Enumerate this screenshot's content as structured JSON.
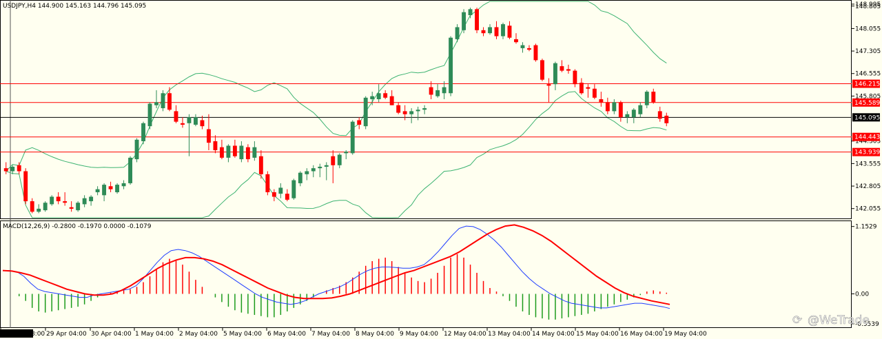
{
  "header": {
    "price_title": "USDJPY,H4  144.900 145.163 144.796 145.095",
    "macd_title": "MACD(12,26,9) -0.2800 -0.1970 0.0000 -0.1079"
  },
  "watermark": "@WeTrade",
  "colors": {
    "background": "#fffff0",
    "bull": "#2e8b57",
    "bear": "#ff0000",
    "band": "#3cb371",
    "hline": "#ff0000",
    "signal": "#ff0000",
    "macd_line": "#1e3cff"
  },
  "chart_data": [
    {
      "type": "candlestick",
      "symbol": "USDJPY",
      "timeframe": "H4",
      "ylim": [
        141.75,
        148.96
      ],
      "price_axis_ticks": [
        "148.995",
        "148.805",
        "148.055",
        "147.305",
        "146.555",
        "145.805",
        "144.305",
        "143.555",
        "142.805",
        "142.055"
      ],
      "price_axis_tick_values": [
        148.995,
        148.805,
        148.055,
        147.305,
        146.555,
        145.805,
        144.305,
        143.555,
        142.805,
        142.055
      ],
      "horizontal_lines": [
        {
          "label": "146.215",
          "value": 146.215
        },
        {
          "label": "145.589",
          "value": 145.589
        },
        {
          "label": "144.443",
          "value": 144.443
        },
        {
          "label": "143.939",
          "value": 143.939
        }
      ],
      "current_price": {
        "label": "145.095",
        "value": 145.095
      },
      "x_axis_labels": [
        "26.04.28 8:00",
        "29 Apr 04:00",
        "30 Apr 04:00",
        "1 May 04:00",
        "2 May 04:00",
        "5 May 04:00",
        "6 May 04:00",
        "7 May 04:00",
        "8 May 04:00",
        "9 May 04:00",
        "12 May 04:00",
        "13 May 04:00",
        "14 May 04:00",
        "15 May 04:00",
        "16 May 04:00",
        "19 May 04:00"
      ],
      "candles": [
        [
          143.4,
          143.6,
          143.2,
          143.3
        ],
        [
          143.3,
          143.5,
          143.2,
          143.45
        ],
        [
          143.5,
          143.6,
          143.2,
          143.3
        ],
        [
          143.3,
          143.4,
          142.2,
          142.3
        ],
        [
          142.3,
          142.4,
          141.9,
          141.95
        ],
        [
          141.95,
          142.2,
          141.9,
          142.05
        ],
        [
          142.0,
          142.3,
          141.95,
          142.25
        ],
        [
          142.2,
          142.5,
          142.15,
          142.45
        ],
        [
          142.45,
          142.6,
          142.2,
          142.3
        ],
        [
          142.3,
          142.6,
          142.15,
          142.25
        ],
        [
          142.1,
          142.3,
          141.95,
          142.05
        ],
        [
          142.0,
          142.3,
          141.95,
          142.25
        ],
        [
          142.2,
          142.5,
          142.1,
          142.4
        ],
        [
          142.3,
          142.5,
          142.15,
          142.45
        ],
        [
          142.6,
          142.8,
          142.5,
          142.7
        ],
        [
          142.5,
          142.9,
          142.3,
          142.85
        ],
        [
          142.8,
          142.95,
          142.6,
          142.7
        ],
        [
          142.6,
          142.9,
          142.55,
          142.85
        ],
        [
          142.8,
          143.0,
          142.7,
          142.9
        ],
        [
          142.9,
          143.8,
          142.85,
          143.75
        ],
        [
          143.7,
          144.4,
          143.6,
          144.35
        ],
        [
          144.3,
          144.95,
          144.2,
          144.9
        ],
        [
          144.8,
          145.6,
          144.7,
          145.55
        ],
        [
          145.5,
          146.0,
          145.4,
          145.6
        ],
        [
          145.4,
          146.0,
          145.3,
          145.9
        ],
        [
          145.9,
          146.1,
          145.3,
          145.35
        ],
        [
          145.3,
          145.5,
          144.9,
          144.95
        ],
        [
          144.9,
          145.1,
          144.75,
          144.85
        ],
        [
          144.9,
          145.2,
          143.8,
          145.1
        ],
        [
          144.85,
          145.2,
          144.8,
          145.1
        ],
        [
          145.0,
          145.15,
          144.7,
          144.8
        ],
        [
          144.7,
          145.2,
          144.0,
          144.25
        ],
        [
          144.3,
          144.5,
          143.9,
          144.0
        ],
        [
          144.1,
          144.35,
          143.7,
          143.75
        ],
        [
          143.75,
          144.2,
          143.6,
          144.15
        ],
        [
          144.15,
          144.35,
          143.75,
          143.8
        ],
        [
          143.7,
          144.3,
          143.6,
          144.15
        ],
        [
          144.1,
          144.2,
          143.6,
          143.7
        ],
        [
          143.75,
          144.3,
          143.65,
          144.1
        ],
        [
          143.8,
          144.0,
          143.05,
          143.2
        ],
        [
          143.2,
          143.3,
          142.5,
          142.6
        ],
        [
          142.6,
          142.7,
          142.3,
          142.45
        ],
        [
          142.55,
          142.9,
          142.4,
          142.75
        ],
        [
          142.55,
          142.7,
          142.3,
          142.35
        ],
        [
          142.4,
          143.05,
          142.35,
          143.0
        ],
        [
          142.9,
          143.3,
          142.8,
          143.25
        ],
        [
          143.2,
          143.4,
          143.0,
          143.3
        ],
        [
          143.3,
          143.5,
          143.1,
          143.4
        ],
        [
          143.4,
          143.55,
          143.1,
          143.45
        ],
        [
          143.45,
          143.6,
          143.0,
          143.5
        ],
        [
          143.8,
          144.0,
          142.9,
          143.5
        ],
        [
          143.5,
          143.9,
          143.4,
          143.85
        ],
        [
          143.9,
          144.0,
          143.7,
          143.95
        ],
        [
          143.9,
          145.0,
          143.85,
          144.95
        ],
        [
          145.0,
          145.1,
          144.7,
          144.85
        ],
        [
          144.8,
          145.8,
          144.7,
          145.75
        ],
        [
          145.7,
          145.95,
          145.5,
          145.8
        ],
        [
          145.7,
          146.2,
          145.6,
          145.9
        ],
        [
          145.9,
          146.0,
          145.7,
          145.75
        ],
        [
          145.8,
          146.0,
          145.5,
          145.5
        ],
        [
          145.5,
          145.6,
          145.2,
          145.25
        ],
        [
          145.3,
          145.5,
          145.0,
          145.2
        ],
        [
          145.2,
          145.4,
          144.9,
          145.3
        ],
        [
          145.3,
          145.45,
          145.0,
          145.35
        ],
        [
          145.35,
          145.5,
          145.2,
          145.4
        ],
        [
          146.1,
          146.3,
          145.7,
          145.85
        ],
        [
          145.8,
          146.2,
          145.75,
          146.0
        ],
        [
          145.9,
          146.3,
          145.7,
          146.1
        ],
        [
          145.9,
          147.8,
          145.8,
          147.75
        ],
        [
          147.7,
          148.2,
          147.6,
          148.1
        ],
        [
          148.0,
          148.7,
          147.9,
          148.6
        ],
        [
          148.5,
          148.75,
          148.4,
          148.7
        ],
        [
          148.7,
          148.75,
          147.9,
          148.0
        ],
        [
          148.0,
          148.1,
          147.8,
          147.9
        ],
        [
          147.9,
          148.2,
          147.85,
          148.1
        ],
        [
          148.1,
          148.3,
          147.7,
          147.8
        ],
        [
          147.8,
          148.25,
          147.7,
          148.2
        ],
        [
          148.15,
          148.3,
          147.7,
          147.75
        ],
        [
          147.7,
          147.9,
          147.55,
          147.6
        ],
        [
          147.4,
          147.6,
          147.25,
          147.5
        ],
        [
          147.4,
          147.5,
          147.3,
          147.35
        ],
        [
          147.5,
          147.55,
          146.95,
          147.0
        ],
        [
          147.0,
          147.05,
          146.3,
          146.35
        ],
        [
          146.2,
          146.4,
          145.6,
          146.15
        ],
        [
          146.2,
          146.95,
          146.0,
          146.9
        ],
        [
          146.8,
          147.0,
          146.6,
          146.65
        ],
        [
          146.7,
          146.85,
          146.55,
          146.65
        ],
        [
          146.65,
          146.7,
          146.1,
          146.2
        ],
        [
          146.25,
          146.4,
          145.85,
          145.9
        ],
        [
          146.1,
          146.2,
          145.75,
          146.05
        ],
        [
          146.05,
          146.2,
          145.7,
          145.75
        ],
        [
          145.7,
          145.95,
          145.45,
          145.6
        ],
        [
          145.6,
          145.75,
          145.2,
          145.3
        ],
        [
          145.3,
          145.7,
          145.2,
          145.6
        ],
        [
          145.6,
          145.65,
          144.95,
          145.1
        ],
        [
          145.1,
          145.3,
          144.9,
          145.2
        ],
        [
          145.1,
          145.4,
          144.9,
          145.35
        ],
        [
          145.2,
          145.6,
          145.1,
          145.5
        ],
        [
          145.5,
          146.0,
          145.4,
          145.95
        ],
        [
          145.95,
          146.05,
          145.55,
          145.6
        ],
        [
          145.3,
          145.45,
          144.95,
          145.05
        ],
        [
          145.15,
          145.25,
          144.8,
          144.9
        ]
      ],
      "bands_note": "upper/middle/lower envelope lines shown in green"
    },
    {
      "type": "macd",
      "params": "MACD(12,26,9)",
      "values_in_title": [
        -0.28,
        -0.197,
        0.0,
        -0.1079
      ],
      "ylim": [
        -0.56,
        1.22
      ],
      "axis_ticks": [
        "1.1529",
        "0.00",
        "-0.5539"
      ],
      "axis_tick_values": [
        1.1529,
        0.0,
        -0.5539
      ],
      "histogram": [
        0.0,
        0.0,
        -0.04,
        -0.12,
        -0.24,
        -0.3,
        -0.32,
        -0.3,
        -0.28,
        -0.26,
        -0.24,
        -0.22,
        -0.18,
        -0.12,
        -0.06,
        0.0,
        0.02,
        0.04,
        0.06,
        0.08,
        0.12,
        0.2,
        0.3,
        0.42,
        0.54,
        0.6,
        0.58,
        0.5,
        0.38,
        0.24,
        0.12,
        0.0,
        -0.06,
        -0.14,
        -0.22,
        -0.28,
        -0.32,
        -0.34,
        -0.36,
        -0.38,
        -0.4,
        -0.4,
        -0.36,
        -0.3,
        -0.24,
        -0.18,
        -0.12,
        -0.06,
        0.0,
        0.06,
        0.1,
        0.14,
        0.2,
        0.28,
        0.38,
        0.48,
        0.56,
        0.6,
        0.62,
        0.56,
        0.46,
        0.36,
        0.28,
        0.22,
        0.2,
        0.26,
        0.36,
        0.48,
        0.62,
        0.68,
        0.62,
        0.5,
        0.36,
        0.22,
        0.1,
        0.04,
        -0.04,
        -0.12,
        -0.22,
        -0.3,
        -0.36,
        -0.4,
        -0.42,
        -0.44,
        -0.44,
        -0.42,
        -0.4,
        -0.38,
        -0.36,
        -0.34,
        -0.3,
        -0.26,
        -0.22,
        -0.18,
        -0.14,
        -0.1,
        -0.06,
        -0.02,
        0.04,
        0.06,
        0.04,
        0.02
      ],
      "macd_line": [
        0.4,
        0.4,
        0.38,
        0.3,
        0.18,
        0.08,
        0.04,
        0.02,
        0.0,
        -0.02,
        -0.04,
        -0.06,
        -0.06,
        -0.02,
        0.0,
        0.02,
        0.04,
        0.06,
        0.08,
        0.14,
        0.26,
        0.4,
        0.54,
        0.66,
        0.74,
        0.76,
        0.74,
        0.7,
        0.64,
        0.56,
        0.48,
        0.4,
        0.32,
        0.24,
        0.16,
        0.08,
        0.0,
        -0.06,
        -0.1,
        -0.14,
        -0.16,
        -0.18,
        -0.16,
        -0.12,
        -0.06,
        0.0,
        0.04,
        0.08,
        0.12,
        0.18,
        0.26,
        0.34,
        0.4,
        0.44,
        0.46,
        0.46,
        0.45,
        0.44,
        0.44,
        0.46,
        0.5,
        0.6,
        0.72,
        0.86,
        1.0,
        1.12,
        1.16,
        1.15,
        1.1,
        1.02,
        0.92,
        0.8,
        0.66,
        0.52,
        0.38,
        0.26,
        0.16,
        0.08,
        0.0,
        -0.06,
        -0.12,
        -0.16,
        -0.18,
        -0.2,
        -0.22,
        -0.24,
        -0.24,
        -0.22,
        -0.2,
        -0.18,
        -0.16,
        -0.16,
        -0.18,
        -0.2,
        -0.22,
        -0.25
      ],
      "signal_line": [
        0.4,
        0.39,
        0.36,
        0.32,
        0.26,
        0.2,
        0.14,
        0.08,
        0.04,
        0.0,
        -0.02,
        -0.02,
        0.0,
        0.06,
        0.14,
        0.24,
        0.34,
        0.44,
        0.52,
        0.58,
        0.62,
        0.62,
        0.6,
        0.56,
        0.5,
        0.42,
        0.34,
        0.26,
        0.18,
        0.1,
        0.04,
        -0.02,
        -0.06,
        -0.08,
        -0.08,
        -0.08,
        -0.07,
        -0.04,
        0.0,
        0.06,
        0.12,
        0.18,
        0.24,
        0.3,
        0.36,
        0.4,
        0.46,
        0.52,
        0.58,
        0.64,
        0.72,
        0.82,
        0.92,
        1.02,
        1.1,
        1.16,
        1.18,
        1.14,
        1.08,
        1.0,
        0.9,
        0.78,
        0.66,
        0.54,
        0.42,
        0.3,
        0.2,
        0.1,
        0.02,
        -0.04,
        -0.08,
        -0.12,
        -0.15,
        -0.18
      ]
    }
  ]
}
